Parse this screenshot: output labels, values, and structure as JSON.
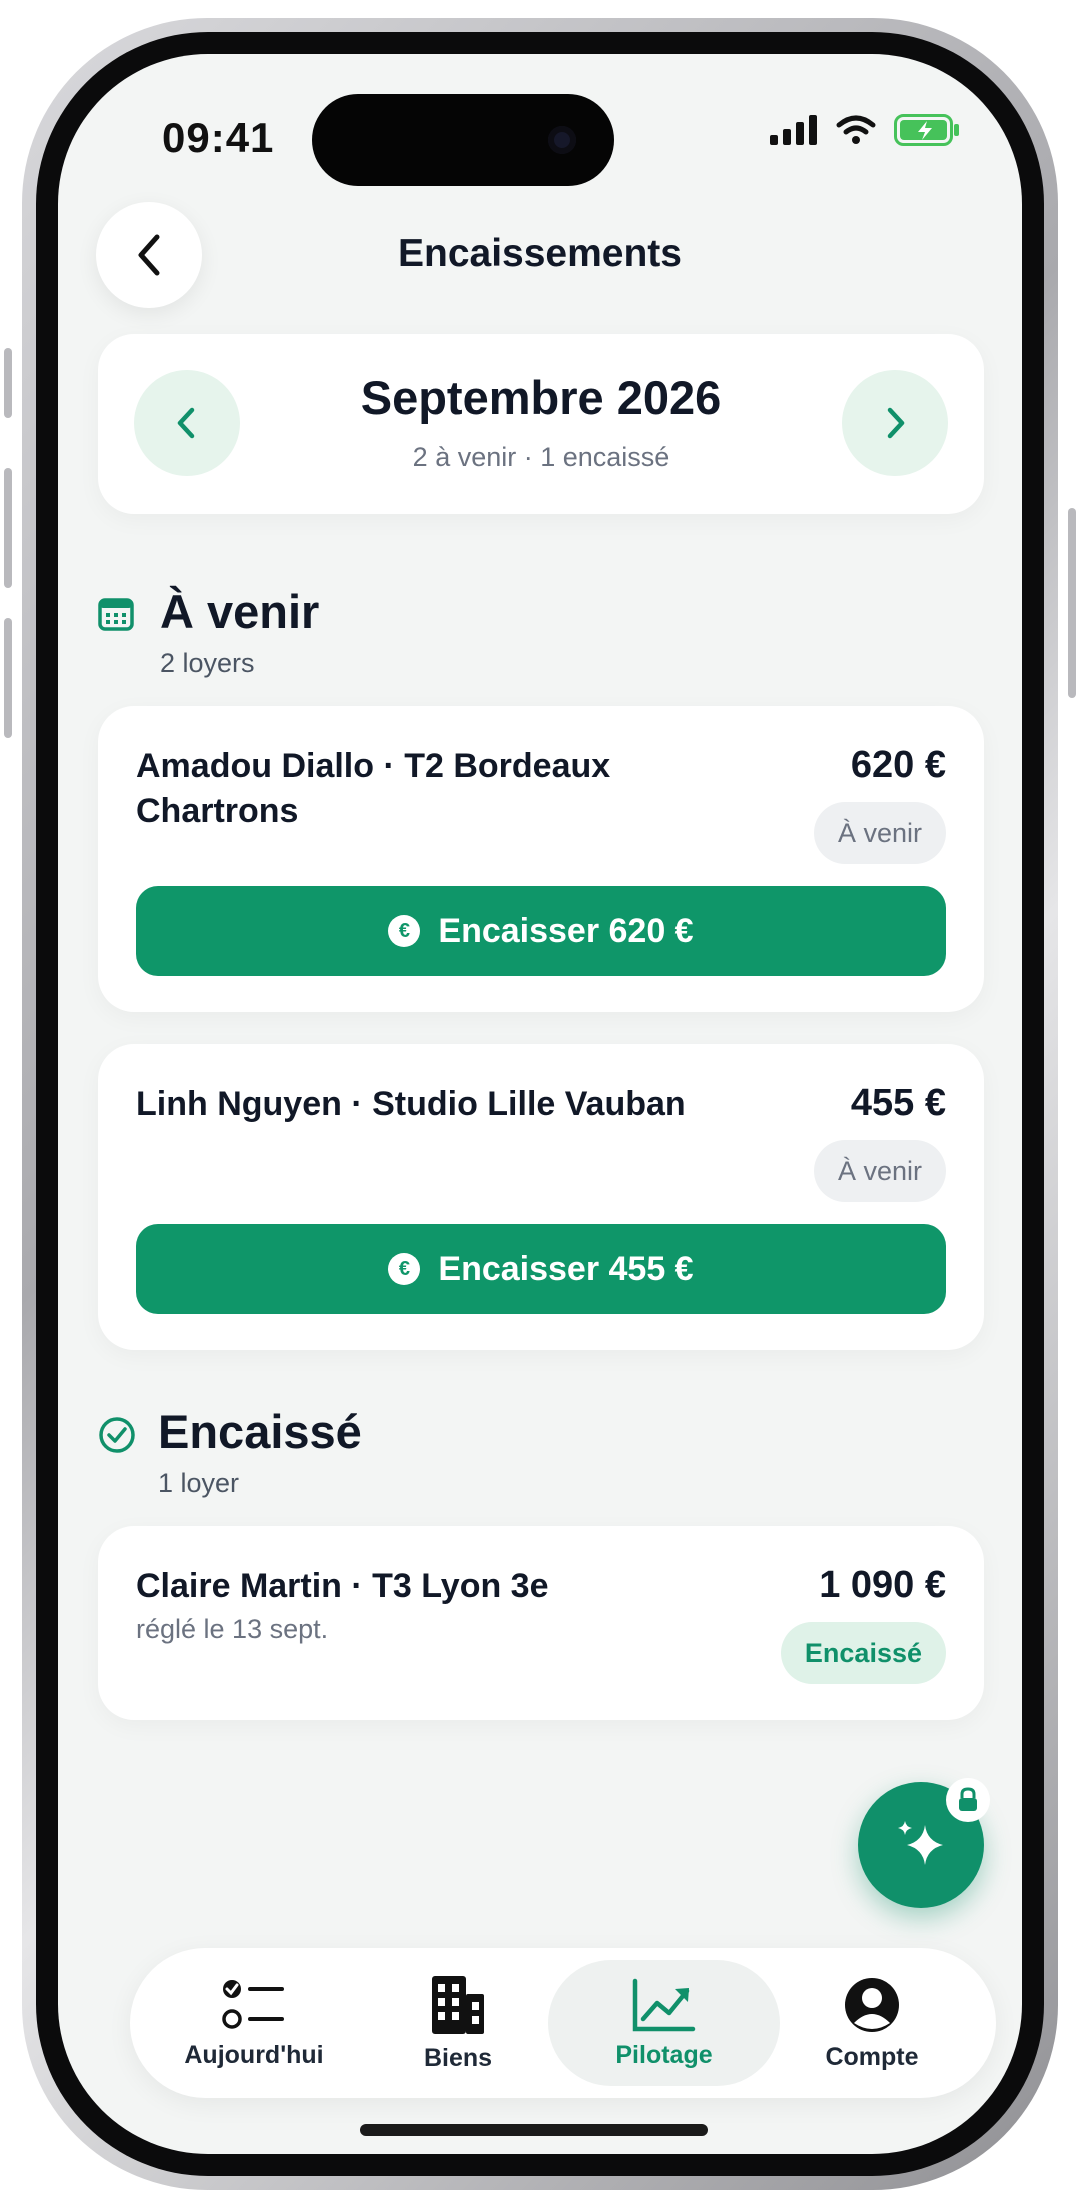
{
  "status_bar": {
    "time": "09:41"
  },
  "header": {
    "title": "Encaissements",
    "back_icon": "chevron-left-icon"
  },
  "month_nav": {
    "title": "Septembre 2026",
    "subtitle": "2 à venir · 1 encaissé",
    "prev_icon": "chevron-left-icon",
    "next_icon": "chevron-right-icon"
  },
  "sections": {
    "upcoming": {
      "title": "À venir",
      "count": "2 loyers",
      "icon": "calendar-icon"
    },
    "collected": {
      "title": "Encaissé",
      "count": "1 loyer",
      "icon": "check-circle-icon"
    }
  },
  "rents": [
    {
      "name": "Amadou Diallo · T2 Bordeaux Chartrons",
      "amount": "620 €",
      "status": "À venir",
      "action": "Encaisser 620 €"
    },
    {
      "name": "Linh Nguyen · Studio Lille Vauban",
      "amount": "455 €",
      "status": "À venir",
      "action": "Encaisser 455 €"
    },
    {
      "name": "Claire Martin · T3 Lyon 3e",
      "detail": "réglé le 13 sept.",
      "amount": "1 090 €",
      "status": "Encaissé"
    }
  ],
  "fab": {
    "icon": "sparkles-icon",
    "lock_icon": "lock-icon"
  },
  "tabbar": {
    "active": "Pilotage",
    "items": [
      {
        "label": "Aujourd'hui",
        "icon": "checklist-icon"
      },
      {
        "label": "Biens",
        "icon": "building-icon"
      },
      {
        "label": "Pilotage",
        "icon": "chart-trend-icon"
      },
      {
        "label": "Compte",
        "icon": "user-circle-icon"
      }
    ]
  },
  "colors": {
    "accent": "#0f9669",
    "background": "#f3f5f4",
    "text": "#111827",
    "muted": "#6b7280"
  }
}
